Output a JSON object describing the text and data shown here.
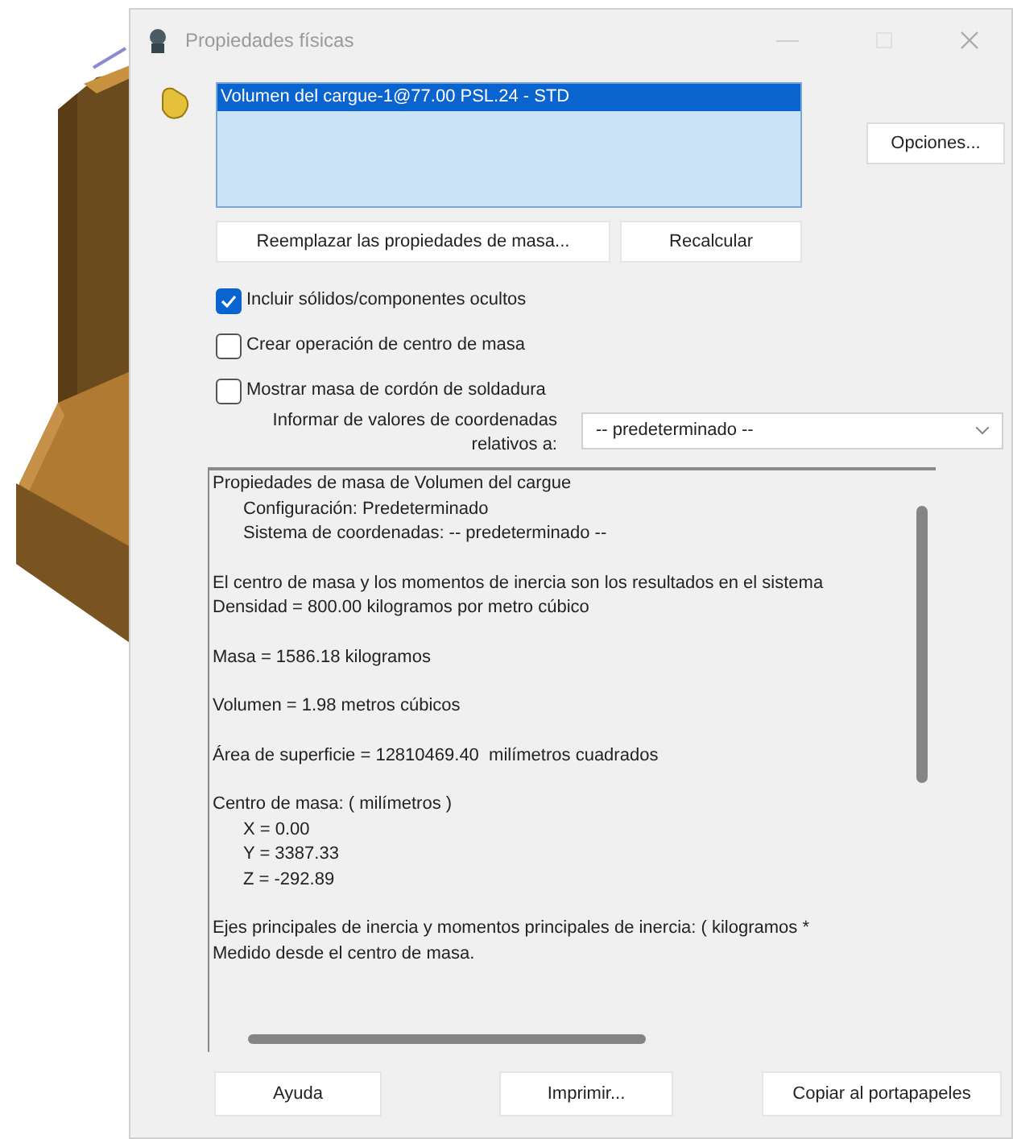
{
  "window": {
    "title": "Propiedades físicas"
  },
  "selection_list": [
    {
      "label": "Volumen del cargue-1@77.00 PSL.24 - STD",
      "selected": true
    }
  ],
  "options_button": "Opciones...",
  "action_buttons": [
    "Reemplazar las propiedades de masa...",
    "Recalcular"
  ],
  "checkboxes": [
    {
      "label": "Incluir sólidos/componentes ocultos",
      "checked": true
    },
    {
      "label": "Crear operación de centro de masa",
      "checked": false
    },
    {
      "label": "Mostrar masa de cordón de soldadura",
      "checked": false
    }
  ],
  "coordinates": {
    "label_lines": [
      "Informar de valores de coordenadas",
      "relativos a:"
    ],
    "value": "-- predeterminado --"
  },
  "report": {
    "paragraphs": [
      {
        "lines": [
          {
            "text": "Propiedades de masa de Volumen del cargue",
            "children": [
              {
                "text": "Configuración: Predeterminado"
              },
              {
                "text": "Sistema de coordenadas: -- predeterminado --"
              }
            ]
          }
        ]
      },
      {
        "lines": [
          {
            "text": "El centro de masa y los momentos de inercia son los resultados en el sistema"
          },
          {
            "text": "Densidad = 800.00 kilogramos por metro cúbico"
          }
        ]
      },
      {
        "lines": [
          {
            "text": "Masa = 1586.18 kilogramos"
          }
        ]
      },
      {
        "lines": [
          {
            "text": "Volumen = 1.98 metros cúbicos"
          }
        ]
      },
      {
        "lines": [
          {
            "text": "Área de superficie = 12810469.40  milímetros cuadrados"
          }
        ]
      },
      {
        "lines": [
          {
            "text": "Centro de masa: ( milímetros )",
            "children": [
              {
                "text": "X = 0.00"
              },
              {
                "text": "Y = 3387.33"
              },
              {
                "text": "Z = -292.89"
              }
            ]
          }
        ]
      },
      {
        "lines": [
          {
            "text": "Ejes principales de inercia y momentos principales de inercia: ( kilogramos *"
          },
          {
            "text": "Medido desde el centro de masa."
          }
        ]
      }
    ]
  },
  "bottom_buttons": [
    "Ayuda",
    "Imprimir...",
    "Copiar al portapapeles"
  ]
}
